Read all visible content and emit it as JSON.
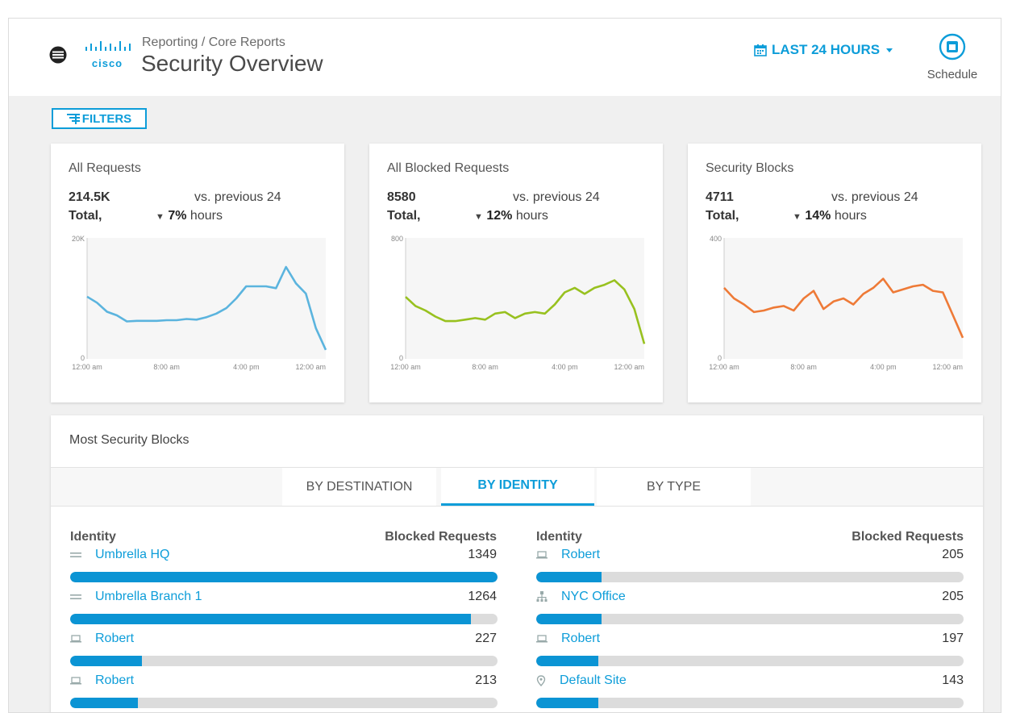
{
  "header": {
    "breadcrumb": "Reporting / Core Reports",
    "title": "Security Overview",
    "logo_text": "cisco",
    "time_filter": "LAST 24 HOURS",
    "schedule_label": "Schedule"
  },
  "filters_label": "FILTERS",
  "colors": {
    "accent": "#0d9dd9",
    "bar": "#0b94d4",
    "chart1": "#5bb4de",
    "chart2": "#98c11f",
    "chart3": "#ee7a37"
  },
  "cards": [
    {
      "title": "All Requests",
      "total_value": "214.5K",
      "total_label": "Total,",
      "vs_line1": "vs. previous 24",
      "change": "7%",
      "vs_line2": "hours",
      "chart_data": {
        "type": "line",
        "ylim": [
          0,
          20000
        ],
        "y_ticks": [
          "20K",
          "0"
        ],
        "x_ticks": [
          "12:00 am",
          "8:00 am",
          "4:00 pm",
          "12:00 am"
        ],
        "x": [
          0,
          1,
          2,
          3,
          4,
          5,
          6,
          7,
          8,
          9,
          10,
          11,
          12,
          13,
          14,
          15,
          16,
          17,
          18,
          19,
          20,
          21,
          22,
          23,
          24
        ],
        "values": [
          10300,
          9300,
          7800,
          7200,
          6200,
          6300,
          6300,
          6300,
          6400,
          6400,
          6600,
          6500,
          6900,
          7500,
          8400,
          10000,
          12000,
          12000,
          12000,
          11700,
          15200,
          12500,
          10800,
          5100,
          1500
        ]
      }
    },
    {
      "title": "All Blocked Requests",
      "total_value": "8580",
      "total_label": "Total,",
      "vs_line1": "vs. previous 24",
      "change": "12%",
      "vs_line2": "hours",
      "chart_data": {
        "type": "line",
        "ylim": [
          0,
          800
        ],
        "y_ticks": [
          "800",
          "0"
        ],
        "x_ticks": [
          "12:00 am",
          "8:00 am",
          "4:00 pm",
          "12:00 am"
        ],
        "x": [
          0,
          1,
          2,
          3,
          4,
          5,
          6,
          7,
          8,
          9,
          10,
          11,
          12,
          13,
          14,
          15,
          16,
          17,
          18,
          19,
          20,
          21,
          22,
          23,
          24
        ],
        "values": [
          410,
          350,
          320,
          280,
          250,
          250,
          260,
          270,
          260,
          300,
          310,
          270,
          300,
          310,
          300,
          360,
          440,
          470,
          430,
          470,
          490,
          520,
          460,
          330,
          100
        ]
      }
    },
    {
      "title": "Security Blocks",
      "total_value": "4711",
      "total_label": "Total,",
      "vs_line1": "vs. previous 24",
      "change": "14%",
      "vs_line2": "hours",
      "chart_data": {
        "type": "line",
        "ylim": [
          0,
          400
        ],
        "y_ticks": [
          "400",
          "0"
        ],
        "x_ticks": [
          "12:00 am",
          "8:00 am",
          "4:00 pm",
          "12:00 am"
        ],
        "x": [
          0,
          1,
          2,
          3,
          4,
          5,
          6,
          7,
          8,
          9,
          10,
          11,
          12,
          13,
          14,
          15,
          16,
          17,
          18,
          19,
          20,
          21,
          22,
          23,
          24
        ],
        "values": [
          235,
          200,
          180,
          155,
          160,
          170,
          175,
          160,
          200,
          225,
          165,
          190,
          200,
          180,
          215,
          235,
          265,
          220,
          230,
          240,
          245,
          225,
          220,
          145,
          70
        ]
      }
    }
  ],
  "most_blocks": {
    "title": "Most Security Blocks",
    "tabs": [
      "BY DESTINATION",
      "BY IDENTITY",
      "BY TYPE"
    ],
    "active_tab": "BY IDENTITY",
    "col_identity": "Identity",
    "col_blocked": "Blocked Requests",
    "max_value": 1349,
    "left": [
      {
        "name": "Umbrella HQ",
        "icon": "network-icon",
        "value": "1349"
      },
      {
        "name": "Umbrella Branch 1",
        "icon": "network-icon",
        "value": "1264"
      },
      {
        "name": "Robert",
        "icon": "laptop-icon",
        "value": "227"
      },
      {
        "name": "Robert",
        "icon": "laptop-icon",
        "value": "213"
      }
    ],
    "right": [
      {
        "name": "Robert",
        "icon": "laptop-icon",
        "value": "205"
      },
      {
        "name": "NYC Office",
        "icon": "network-tree-icon",
        "value": "205"
      },
      {
        "name": "Robert",
        "icon": "laptop-icon",
        "value": "197"
      },
      {
        "name": "Default Site",
        "icon": "location-pin-icon",
        "value": "143"
      }
    ]
  }
}
